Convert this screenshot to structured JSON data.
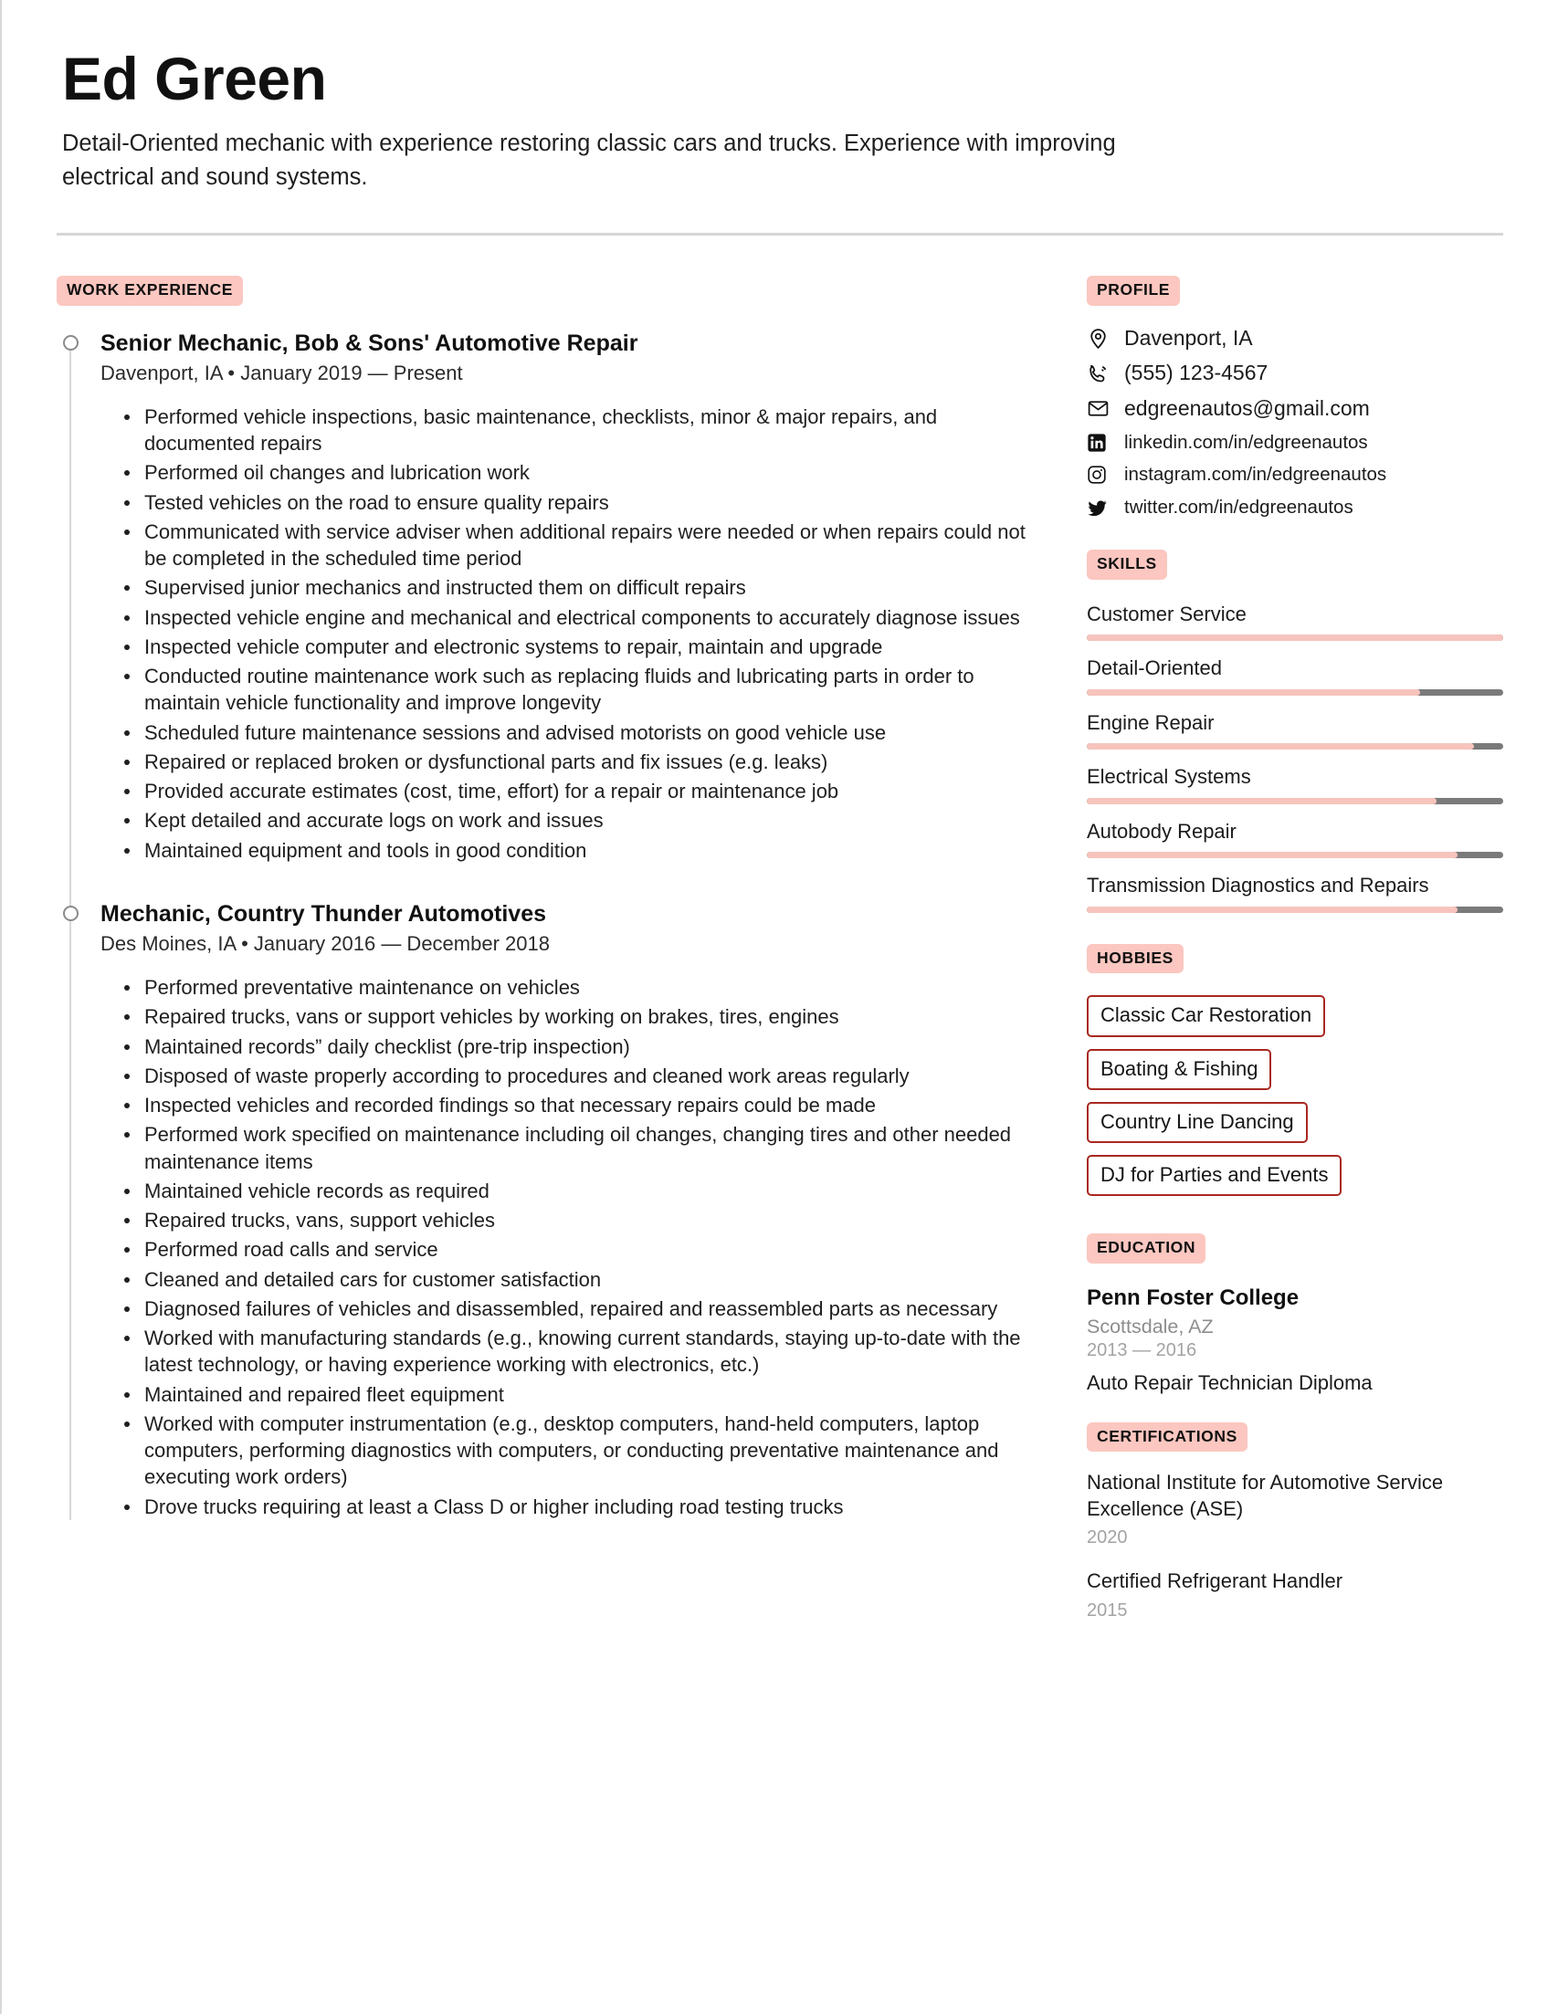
{
  "header": {
    "name": "Ed Green",
    "summary": "Detail-Oriented mechanic with experience restoring classic cars and trucks. Experience with improving electrical and sound systems."
  },
  "work_experience": {
    "section_label": "WORK EXPERIENCE",
    "entries": [
      {
        "title": "Senior Mechanic, Bob & Sons' Automotive Repair",
        "meta": "Davenport, IA • January 2019 — Present",
        "bullets": [
          "Performed vehicle inspections, basic maintenance, checklists, minor & major repairs, and documented repairs",
          "Performed oil changes and lubrication work",
          "Tested vehicles on the road to ensure quality repairs",
          "Communicated with service adviser when additional repairs were needed or when repairs could not be completed in the scheduled time period",
          "Supervised junior mechanics and instructed them on difficult repairs",
          "Inspected vehicle engine and mechanical and electrical components to accurately diagnose issues",
          "Inspected vehicle computer and electronic systems to repair, maintain and upgrade",
          "Conducted routine maintenance work such as replacing fluids and lubricating parts in order to maintain vehicle functionality and improve longevity",
          "Scheduled future maintenance sessions and advised motorists on good vehicle use",
          "Repaired or replaced broken or dysfunctional parts and fix issues (e.g. leaks)",
          "Provided accurate estimates (cost, time, effort) for a repair or maintenance job",
          "Kept detailed and accurate logs on work and issues",
          "Maintained equipment and tools in good condition"
        ]
      },
      {
        "title": "Mechanic, Country Thunder Automotives",
        "meta": "Des Moines, IA • January 2016 — December 2018",
        "bullets": [
          "Performed preventative maintenance on vehicles",
          "Repaired trucks, vans or support vehicles by working on brakes, tires, engines",
          "Maintained records” daily checklist (pre-trip inspection)",
          "Disposed of waste properly according to procedures and cleaned work areas regularly",
          "Inspected vehicles and recorded findings so that necessary repairs could be made",
          "Performed work specified on maintenance including oil changes, changing tires and other needed maintenance items",
          "Maintained vehicle records as required",
          "Repaired trucks, vans, support vehicles",
          "Performed road calls and service",
          "Cleaned and detailed cars for customer satisfaction",
          "Diagnosed failures of vehicles and disassembled, repaired and reassembled parts as necessary",
          "Worked with manufacturing standards (e.g., knowing current standards, staying up-to-date with the latest technology, or having experience working with electronics, etc.)",
          "Maintained and repaired fleet equipment",
          "Worked with computer instrumentation (e.g., desktop computers, hand-held computers, laptop computers, performing diagnostics with computers, or conducting preventative maintenance and executing work orders)",
          "Drove trucks requiring at least a Class D or higher including road testing trucks"
        ]
      }
    ]
  },
  "profile": {
    "section_label": "PROFILE",
    "location": "Davenport, IA",
    "phone": "(555) 123-4567",
    "email": "edgreenautos@gmail.com",
    "linkedin": "linkedin.com/in/edgreenautos",
    "instagram": "instagram.com/in/edgreenautos",
    "twitter": "twitter.com/in/edgreenautos"
  },
  "skills": {
    "section_label": "SKILLS",
    "items": [
      {
        "name": "Customer Service",
        "level": 100
      },
      {
        "name": "Detail-Oriented",
        "level": 80
      },
      {
        "name": "Engine Repair",
        "level": 93
      },
      {
        "name": "Electrical Systems",
        "level": 84
      },
      {
        "name": "Autobody Repair",
        "level": 89
      },
      {
        "name": "Transmission Diagnostics and Repairs",
        "level": 89
      }
    ]
  },
  "hobbies": {
    "section_label": "HOBBIES",
    "items": [
      "Classic Car Restoration",
      "Boating & Fishing",
      "Country Line Dancing",
      "DJ for Parties and Events"
    ]
  },
  "education": {
    "section_label": "EDUCATION",
    "school": "Penn Foster College",
    "location": "Scottsdale, AZ",
    "years": "2013 — 2016",
    "degree": "Auto Repair Technician Diploma"
  },
  "certifications": {
    "section_label": "CERTIFICATIONS",
    "items": [
      {
        "name": "National Institute for Automotive Service Excellence (ASE)",
        "year": "2020"
      },
      {
        "name": "Certified Refrigerant Handler",
        "year": "2015"
      }
    ]
  },
  "colors": {
    "badge_bg": "#FBC7C0",
    "skill_fill": "#F7C4BD",
    "skill_track": "#7A7A7A",
    "hobby_border": "#A82820",
    "muted_text": "#A3A3A3"
  }
}
